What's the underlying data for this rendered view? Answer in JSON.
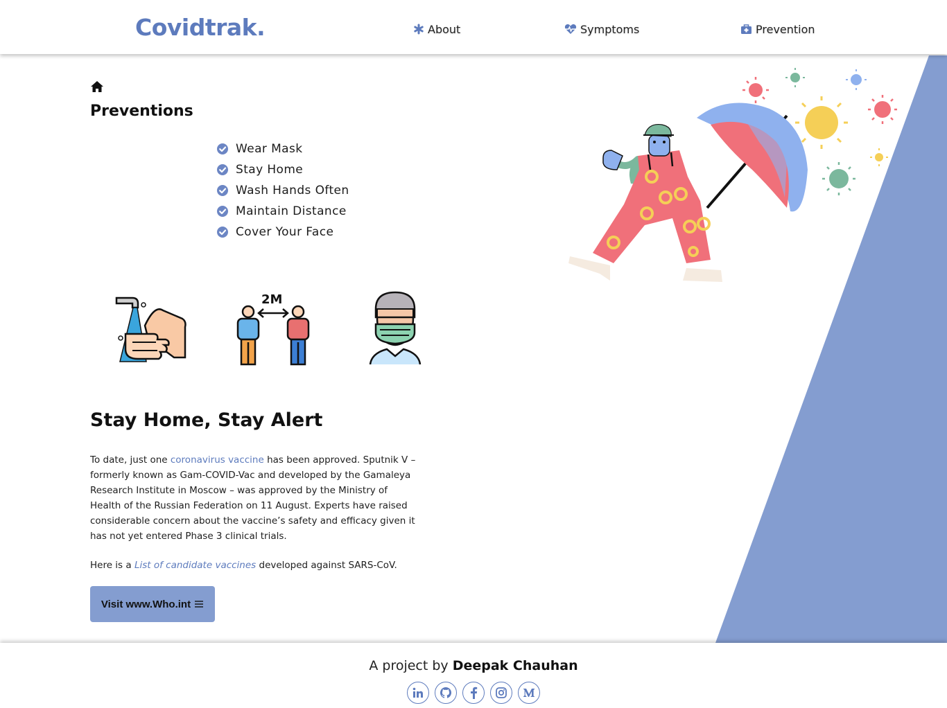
{
  "navbar": {
    "brand": "Covidtrak.",
    "items": [
      {
        "label": "About",
        "icon": "asterisk-icon"
      },
      {
        "label": "Symptoms",
        "icon": "heartbeat-icon"
      },
      {
        "label": "Prevention",
        "icon": "medkit-icon"
      }
    ]
  },
  "colors": {
    "accent": "#5d7bbd",
    "panel": "#849dd0"
  },
  "main": {
    "section_title": "Preventions",
    "prevention_items": [
      "Wear Mask",
      "Stay Home",
      "Wash Hands Often",
      "Maintain Distance",
      "Cover Your Face"
    ],
    "distance_label": "2M",
    "headline": "Stay Home, Stay Alert",
    "paragraph": {
      "before_link": "To date, just one ",
      "link_text": "coronavirus vaccine",
      "after_link": " has been approved. Sputnik V – formerly known as Gam-COVID-Vac and developed by the Gamaleya Research Institute in Moscow – was approved by the Ministry of Health of the Russian Federation on 11 August. Experts have raised considerable concern about the vaccine’s safety and efficacy given it has not yet entered Phase 3 clinical trials."
    },
    "paragraph2": {
      "before_link": "Here is a ",
      "link_text": "List of candidate vaccines",
      "after_link": " developed against SARS-CoV."
    },
    "button_label": "Visit www.Who.int"
  },
  "footer": {
    "prefix": "A project by ",
    "author": "Deepak Chauhan",
    "socials": [
      "linkedin-icon",
      "github-icon",
      "facebook-icon",
      "instagram-icon",
      "medium-icon"
    ]
  }
}
